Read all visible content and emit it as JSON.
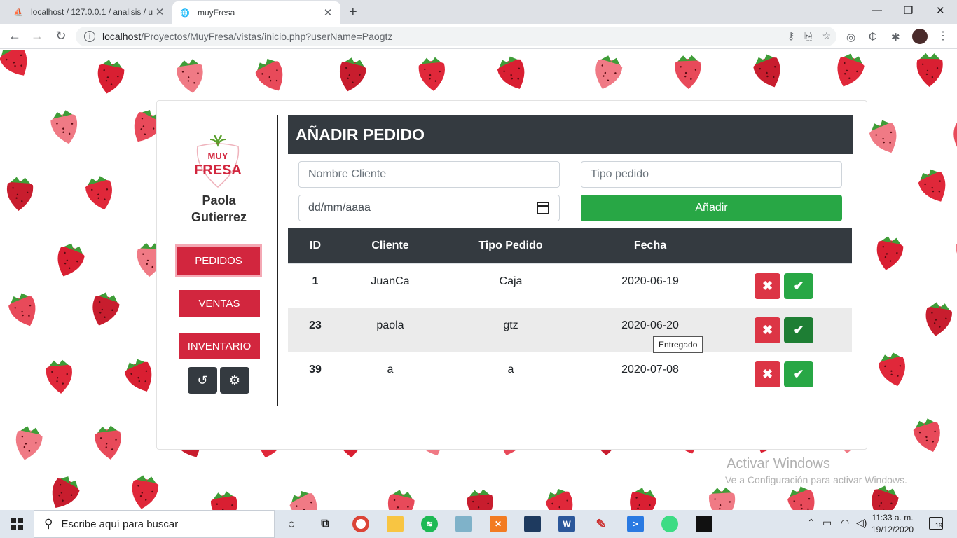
{
  "browser": {
    "tabs": [
      {
        "title": "localhost / 127.0.0.1 / analisis / u"
      },
      {
        "title": "muyFresa"
      }
    ],
    "url_host": "localhost",
    "url_path": "/Proyectos/MuyFresa/vistas/inicio.php?userName=Paogtz"
  },
  "sidebar": {
    "logo_top": "MUY",
    "logo_bottom": "FRESA",
    "user_first": "Paola",
    "user_last": "Gutierrez",
    "nav": [
      "PEDIDOS",
      "VENTAS",
      "INVENTARIO"
    ]
  },
  "form": {
    "title": "AÑADIR PEDIDO",
    "cliente_placeholder": "Nombre Cliente",
    "tipo_placeholder": "Tipo pedido",
    "fecha_placeholder": "dd/mm/aaaa",
    "add_label": "Añadir"
  },
  "table": {
    "headers": [
      "ID",
      "Cliente",
      "Tipo Pedido",
      "Fecha"
    ],
    "rows": [
      {
        "id": "1",
        "cliente": "JuanCa",
        "tipo": "Caja",
        "fecha": "2020-06-19"
      },
      {
        "id": "23",
        "cliente": "paola",
        "tipo": "gtz",
        "fecha": "2020-06-20"
      },
      {
        "id": "39",
        "cliente": "a",
        "tipo": "a",
        "fecha": "2020-07-08"
      }
    ],
    "tooltip": "Entregado"
  },
  "watermark": {
    "line1": "Activar Windows",
    "line2": "Ve a Configuración para activar Windows."
  },
  "taskbar": {
    "search_placeholder": "Escribe aquí para buscar",
    "time": "11:33 a. m.",
    "date": "19/12/2020",
    "notifications": "19"
  },
  "colors": {
    "brand_red": "#d2263e",
    "dark": "#343a40",
    "success": "#28a745",
    "danger": "#dc3545"
  }
}
